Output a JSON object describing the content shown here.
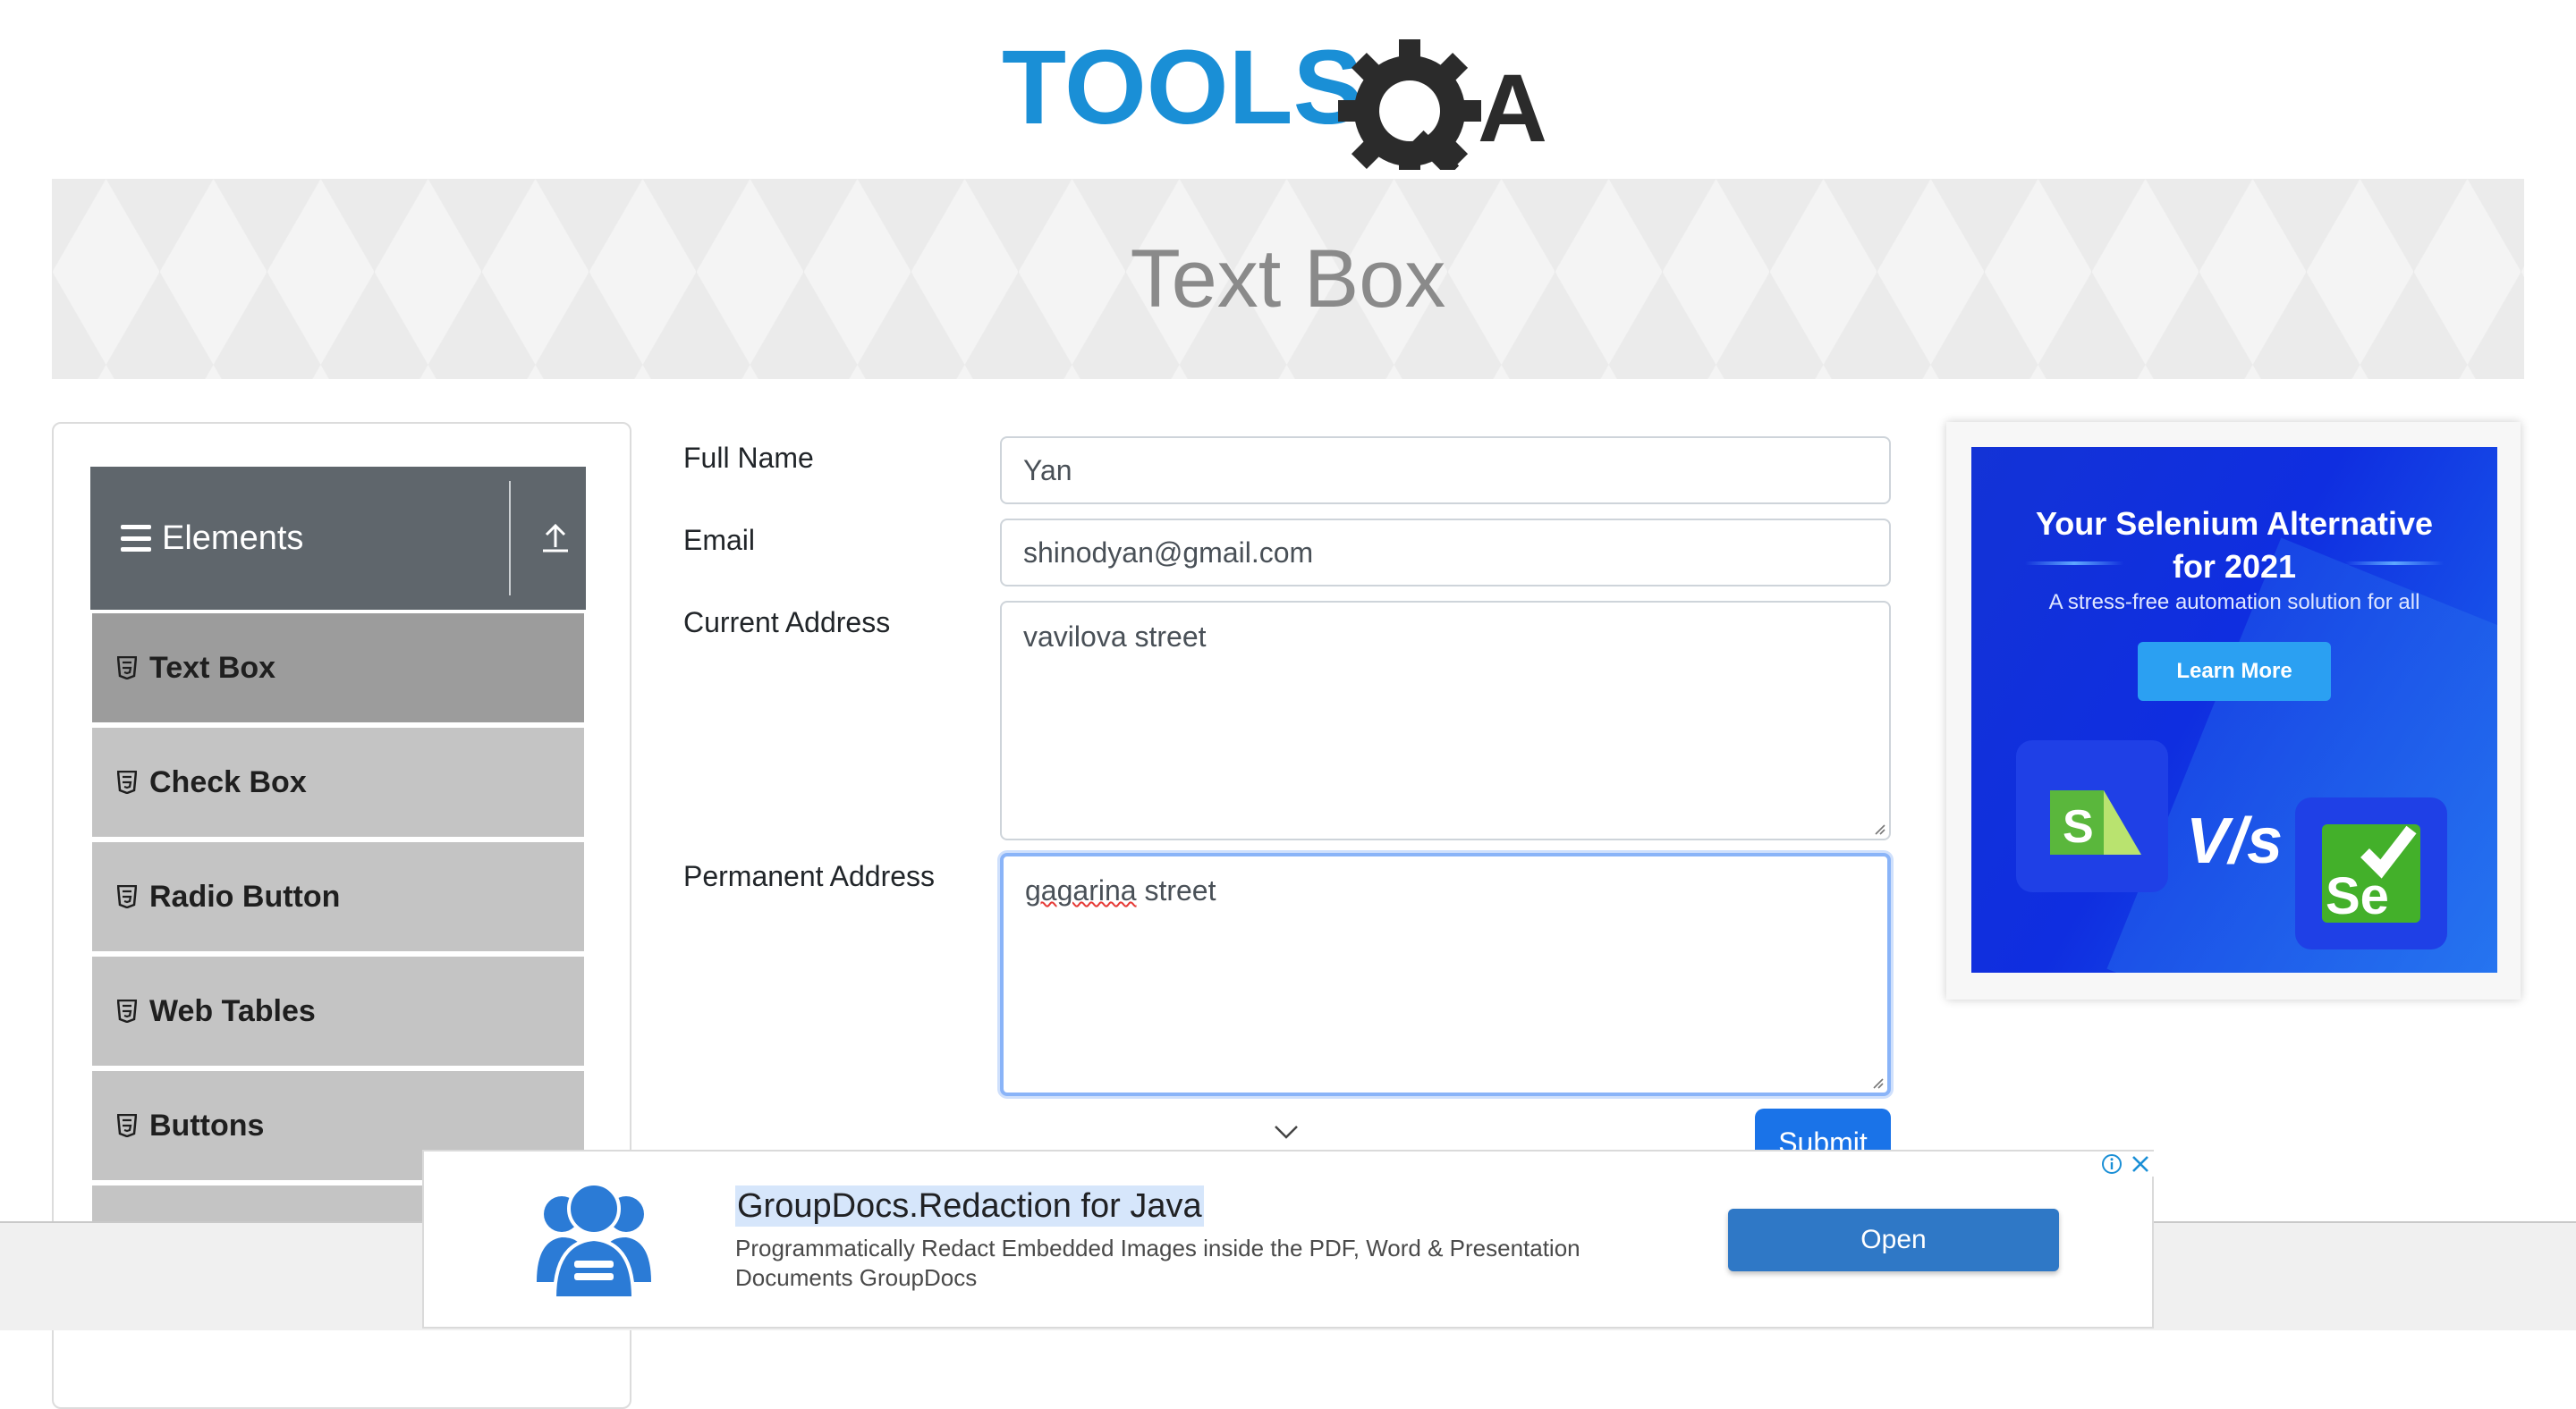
{
  "logo": {
    "text_left": "TOOLS",
    "text_right": "QA"
  },
  "page": {
    "title": "Text Box"
  },
  "sidebar": {
    "group_title": "Elements",
    "items": [
      {
        "label": "Text Box",
        "active": true
      },
      {
        "label": "Check Box"
      },
      {
        "label": "Radio Button"
      },
      {
        "label": "Web Tables"
      },
      {
        "label": "Buttons"
      }
    ]
  },
  "form": {
    "full_name": {
      "label": "Full Name",
      "value": "Yan"
    },
    "email": {
      "label": "Email",
      "value": "shinodyan@gmail.com"
    },
    "current_address": {
      "label": "Current Address",
      "value": "vavilova street"
    },
    "permanent_address": {
      "label": "Permanent Address",
      "value_misspelled": "gagarina",
      "value_rest": " street"
    },
    "submit_label": "Submit"
  },
  "side_ad": {
    "title_line1": "Your Selenium Alternative",
    "title_line2": "for 2021",
    "subtitle": "A stress-free automation solution for all",
    "button": "Learn More",
    "vs": "V/s",
    "se": "Se"
  },
  "bottom_ad": {
    "title": "GroupDocs.Redaction for Java",
    "description": "Programmatically Redact Embedded Images inside the PDF, Word & Presentation Documents GroupDocs",
    "button": "Open",
    "info_icon": "info-icon",
    "close_icon": "close-icon"
  },
  "colors": {
    "logo_blue": "#1a8fd6",
    "logo_dark": "#2b2b2b",
    "sidebar_header": "#5f666c",
    "menu_item": "#c4c4c4",
    "menu_active": "#9c9c9c",
    "submit": "#1a73e8",
    "open_button": "#2f78c6"
  }
}
